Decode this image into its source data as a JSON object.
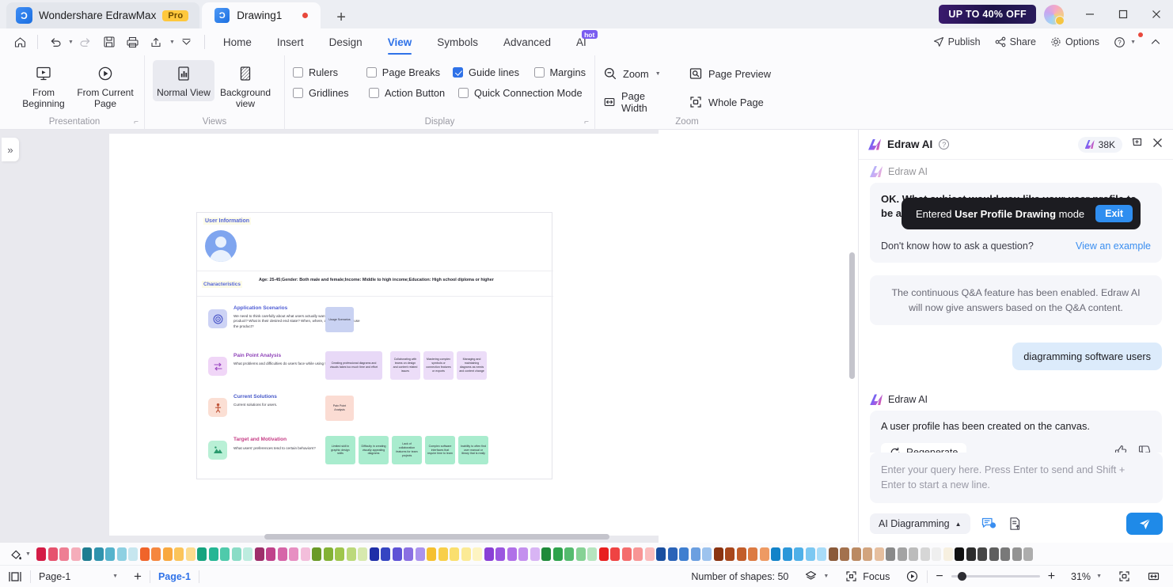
{
  "titlebar": {
    "app_name": "Wondershare EdrawMax",
    "pro_badge": "Pro",
    "doc_tab": "Drawing1",
    "new_tab_icon": "plus-icon",
    "promo": "UP TO 40% OFF",
    "minimize_icon": "minimize-icon",
    "maximize_icon": "maximize-icon",
    "close_icon": "close-icon"
  },
  "quickaccess": {
    "home_icon": "home-icon",
    "undo_icon": "undo-icon",
    "redo_icon": "redo-icon",
    "save_icon": "save-icon",
    "print_icon": "print-icon",
    "export_icon": "export-icon",
    "more_icon": "chevron-down-icon"
  },
  "menu": {
    "tabs": [
      {
        "label": "Home",
        "active": false
      },
      {
        "label": "Insert",
        "active": false
      },
      {
        "label": "Design",
        "active": false
      },
      {
        "label": "View",
        "active": true
      },
      {
        "label": "Symbols",
        "active": false
      },
      {
        "label": "Advanced",
        "active": false
      },
      {
        "label": "AI",
        "active": false,
        "badge": "hot"
      }
    ],
    "right": {
      "publish": "Publish",
      "share": "Share",
      "options": "Options",
      "help_icon": "help-icon",
      "collapse_icon": "chevron-up-icon"
    }
  },
  "ribbon": {
    "groups": [
      {
        "name": "Presentation",
        "label": "Presentation",
        "buttons": [
          {
            "label": "From Beginning",
            "icon": "present-from-beginning-icon"
          },
          {
            "label": "From Current Page",
            "icon": "present-from-current-icon"
          }
        ],
        "expander": true
      },
      {
        "name": "Views",
        "label": "Views",
        "buttons": [
          {
            "label": "Normal View",
            "icon": "normal-view-icon",
            "selected": true
          },
          {
            "label": "Background view",
            "icon": "background-view-icon",
            "selected": false
          }
        ],
        "expander": false
      },
      {
        "name": "Display",
        "label": "Display",
        "checkboxes": [
          {
            "label": "Rulers",
            "checked": false
          },
          {
            "label": "Page Breaks",
            "checked": false
          },
          {
            "label": "Guide lines",
            "checked": true
          },
          {
            "label": "Margins",
            "checked": false
          },
          {
            "label": "Gridlines",
            "checked": false
          },
          {
            "label": "Action Button",
            "checked": false
          },
          {
            "label": "Quick Connection Mode",
            "checked": false
          }
        ],
        "expander": true
      },
      {
        "name": "Zoom",
        "label": "Zoom",
        "items": [
          {
            "label": "Zoom",
            "icon": "zoom-out-icon",
            "dropdown": true
          },
          {
            "label": "Page Preview",
            "icon": "page-preview-icon"
          },
          {
            "label": "Page Width",
            "icon": "page-width-icon"
          },
          {
            "label": "Whole Page",
            "icon": "whole-page-icon"
          }
        ]
      }
    ]
  },
  "canvas": {
    "collapse_icon": "chevrons-right-icon",
    "diagram": {
      "section_title": "User Information",
      "avatar_icon": "user-avatar-icon",
      "characteristics_label": "Characteristics",
      "characteristics_text": "Age: 25-45;Gender: Both male and female;Income: Middle to high income;Education: High school diploma or higher",
      "rows": [
        {
          "title": "Application Scenarios",
          "icon": "target-icon",
          "desc": "We need to think carefully about what users actually want to get from the product? What is their desired end state? When, where, and how do users use the product?",
          "title_color": "#4d5bd4",
          "icon_bg": "#cdd3f5",
          "chips": [
            {
              "text": "Usage Scenarios",
              "bg": "#c9d2f2",
              "w": 36,
              "h": 32
            }
          ]
        },
        {
          "title": "Pain Point Analysis",
          "icon": "arrows-icon",
          "desc": "What problems and difficulties do users face while using the product?",
          "title_color": "#8e42b8",
          "icon_bg": "#f0d6f7",
          "chips": [
            {
              "text": "Creating professional diagrams and visuals takes too much time and effort",
              "bg": "#e8d9f7",
              "w": 72,
              "h": 36
            },
            {
              "text": "Collaborating with teams on design and content related issues",
              "bg": "#ecddf8",
              "w": 38,
              "h": 36
            },
            {
              "text": "Mastering complex symbols or connection features or exports",
              "bg": "#ecddf8",
              "w": 38,
              "h": 36
            },
            {
              "text": "Managing and maintaining diagrams as needs and content change",
              "bg": "#ecddf8",
              "w": 38,
              "h": 36
            }
          ]
        },
        {
          "title": "Current Solutions",
          "icon": "person-icon",
          "desc": "Current solutions for users.",
          "title_color": "#4557c8",
          "icon_bg": "#fbdfd4",
          "chips": [
            {
              "text": "Pain Point Analysis",
              "bg": "#fbdcd3",
              "w": 36,
              "h": 32
            }
          ]
        },
        {
          "title": "Target and Motivation",
          "icon": "mountain-icon",
          "desc": "What users' preferences tend to certain behaviors?",
          "title_color": "#c53b84",
          "icon_bg": "#b9f0d6",
          "chips": [
            {
              "text": "Limited skill in graphic design skills",
              "bg": "#a9ecce",
              "w": 38,
              "h": 36
            },
            {
              "text": "Difficulty in creating visually appealing diagrams",
              "bg": "#a9ecce",
              "w": 38,
              "h": 36
            },
            {
              "text": "Lack of collaboration features for team projects",
              "bg": "#a9ecce",
              "w": 38,
              "h": 36
            },
            {
              "text": "Complex software interfaces that require time to learn",
              "bg": "#a9ecce",
              "w": 38,
              "h": 36
            },
            {
              "text": "Inability to often find user manual or library that is really",
              "bg": "#a9ecce",
              "w": 38,
              "h": 36
            }
          ]
        }
      ]
    }
  },
  "ai_panel": {
    "title": "Edraw AI",
    "help_icon": "help-circle-icon",
    "credits": "38K",
    "cart_icon": "cart-icon",
    "close_icon": "close-icon",
    "toast": {
      "prefix": "Entered ",
      "bold": "User Profile Drawing",
      "suffix": " mode",
      "exit": "Exit"
    },
    "messages": [
      {
        "type": "ai-question",
        "sender": "Edraw AI",
        "text": "OK. What subject would you like your user profile to be about?",
        "hint": "Don't know how to ask a question?",
        "hint_link": "View an example"
      },
      {
        "type": "notice",
        "text": "The continuous Q&A feature has been enabled. Edraw AI will now give answers based on the Q&A content."
      },
      {
        "type": "user",
        "text": "diagramming software users"
      },
      {
        "type": "ai-reply",
        "sender": "Edraw AI",
        "text": "A user profile has been created on the canvas.",
        "regenerate": "Regenerate",
        "thumbs_up_icon": "thumbs-up-icon",
        "thumbs_down_icon": "thumbs-down-icon"
      }
    ],
    "input": {
      "placeholder": "Enter your query here. Press Enter to send and Shift + Enter to start a new line.",
      "mode": "AI Diagramming",
      "mode_caret_icon": "chevron-up-icon",
      "chat_tool_icon": "ai-chat-icon",
      "doc_tool_icon": "ai-document-icon",
      "send_icon": "send-icon"
    }
  },
  "colorbar": {
    "fill_tool_icon": "fill-color-icon",
    "swatches": [
      "#d41c46",
      "#e6536e",
      "#ee7e93",
      "#f5adba",
      "#1f7d91",
      "#2f93ad",
      "#55b3cc",
      "#8ed0e2",
      "#c6e6ef",
      "#f0642a",
      "#f5873f",
      "#f9a83f",
      "#fbc45a",
      "#fbdb8e",
      "#15a37f",
      "#25b694",
      "#4fcaab",
      "#8adcc6",
      "#bdecdf",
      "#9e2f6b",
      "#c0428b",
      "#d665a8",
      "#e78fc2",
      "#f3bedb",
      "#6a9a28",
      "#83b235",
      "#9fc64c",
      "#bcd97b",
      "#d7e9ae",
      "#1f2fa8",
      "#3545c2",
      "#5e52d6",
      "#8a6fe2",
      "#ab93ee",
      "#f5c030",
      "#f8cf4a",
      "#fadf6e",
      "#fbea95",
      "#fdf4c2",
      "#8a3fd6",
      "#9b56e0",
      "#b070e8",
      "#c490ee",
      "#d8b4f4",
      "#1f8a3a",
      "#2fa34c",
      "#55bb6e",
      "#86d295",
      "#b6e5bf",
      "#e81f1f",
      "#ef4343",
      "#f46d6d",
      "#f89595",
      "#fbbcbc",
      "#1a4fa0",
      "#2a63b8",
      "#3f7fd0",
      "#6b9fe0",
      "#9dc3ee",
      "#8a3310",
      "#a8471c",
      "#c25d2a",
      "#dc7a42",
      "#ee9a63",
      "#1283c9",
      "#2b97d9",
      "#4fb0e8",
      "#7cc8f2",
      "#a8dcf8",
      "#8a5a3a",
      "#a3714d",
      "#bb8a63",
      "#d2a47e",
      "#e6bf9f",
      "#8a8a8a",
      "#a3a3a3",
      "#bcbcbc",
      "#d6d6d6",
      "#efefef",
      "#f7f0e0",
      "#111111",
      "#2b2b2b",
      "#454545",
      "#5f5f5f",
      "#797979",
      "#939393",
      "#adadad"
    ]
  },
  "statusbar": {
    "layout_icon": "page-layout-icon",
    "page_select": "Page-1",
    "add_page_icon": "plus-icon",
    "page_tab": "Page-1",
    "shapes_count": "Number of shapes: 50",
    "layers_icon": "layers-icon",
    "focus_label": "Focus",
    "focus_icon": "focus-icon",
    "play_icon": "play-icon",
    "zoom_out_icon": "minus-icon",
    "zoom_in_icon": "plus-icon",
    "zoom_level": "31%",
    "fit_page_icon": "fit-page-icon",
    "fit_width_icon": "fit-width-icon"
  }
}
